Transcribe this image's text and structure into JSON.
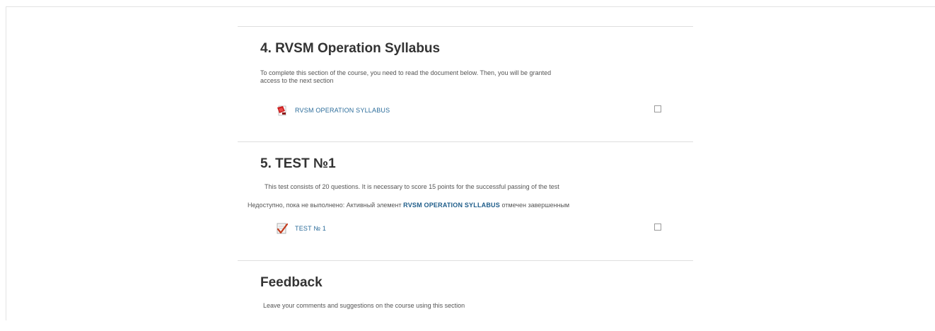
{
  "sections": [
    {
      "title": "4. RVSM Operation Syllabus",
      "summary_line1": "To complete this section of the course, you need to read the document below. Then, you will be granted",
      "summary_line2": "access to the next section",
      "activity": {
        "label": "RVSM OPERATION SYLLABUS",
        "icon": "pdf-document-icon"
      }
    },
    {
      "title": "5. TEST №1",
      "summary": "This test consists of 20 questions. It is necessary to score 15 points for the successful passing of the test",
      "restriction": {
        "prefix": "Недоступно, пока не выполнено: Активный элемент",
        "activity_name": "RVSM OPERATION SYLLABUS",
        "suffix": "отмечен завершенным"
      },
      "activity": {
        "label": "TEST № 1",
        "icon": "quiz-checkmark-icon"
      }
    },
    {
      "title": "Feedback",
      "summary": "Leave your comments and suggestions on the course using this section"
    }
  ],
  "colors": {
    "link": "#2b6c9a",
    "title": "#333333",
    "divider": "#dedede"
  }
}
